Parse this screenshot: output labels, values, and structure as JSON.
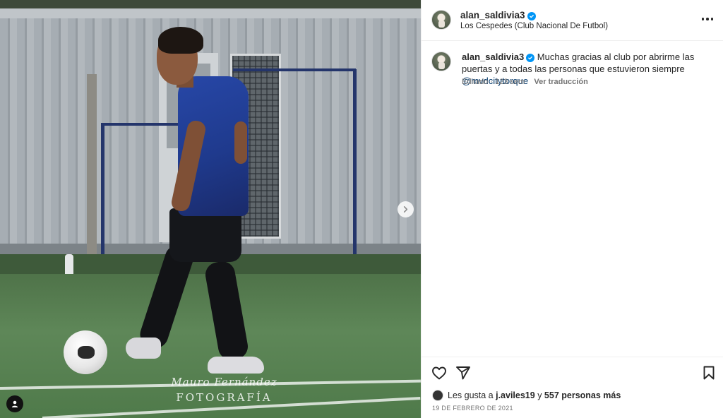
{
  "post": {
    "username": "alan_saldivia3",
    "location": "Los Cespedes (Club Nacional De Futbol)"
  },
  "caption": {
    "username": "alan_saldivia3",
    "text": "Muchas gracias al club por abrirme las puertas y a todas las personas que estuvieron siempre ",
    "mention": "@mvdcitytorque",
    "edited_label": "Editado",
    "separator": "·",
    "age": "123 sem",
    "translate_label": "Ver traducción"
  },
  "photo": {
    "watermark_name": "Mauro Fernández",
    "watermark_sub": "FOTOGRAFÍA"
  },
  "likes": {
    "prefix": "Les gusta a ",
    "first_user": "j.aviles19",
    "conjunction": " y ",
    "others": "557 personas más"
  },
  "date": "19 DE FEBRERO DE 2021",
  "icons": {
    "verified": "verified-badge-icon",
    "more": "more-options-icon",
    "next": "chevron-right-icon",
    "user_tag": "user-tag-icon",
    "like": "heart-icon",
    "share": "send-icon",
    "save": "bookmark-icon"
  },
  "colors": {
    "verified_blue": "#0095f6",
    "mention": "#00376b",
    "secondary_text": "#737373",
    "jersey_blue": "#1f3a8d"
  }
}
